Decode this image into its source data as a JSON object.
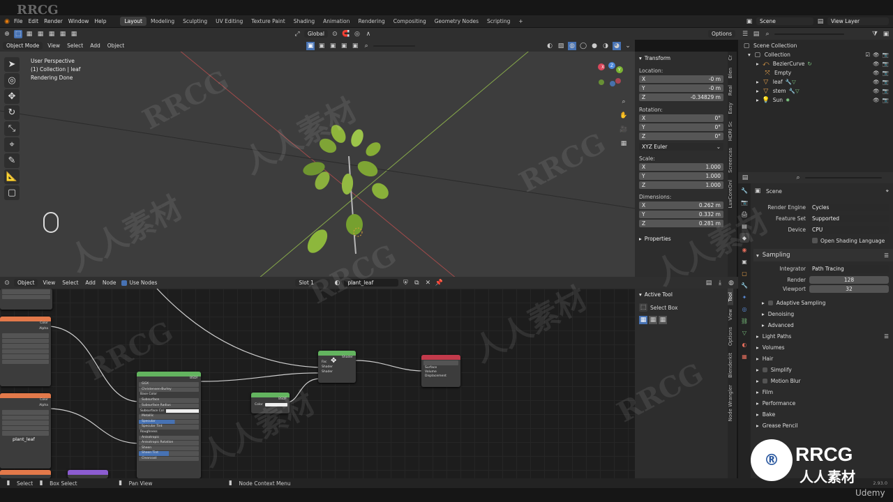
{
  "menubar": {
    "items": [
      "File",
      "Edit",
      "Render",
      "Window",
      "Help"
    ],
    "workspaces": [
      "Layout",
      "Modeling",
      "Sculpting",
      "UV Editing",
      "Texture Paint",
      "Shading",
      "Animation",
      "Rendering",
      "Compositing",
      "Geometry Nodes",
      "Scripting"
    ],
    "active_workspace": "Layout",
    "add_workspace": "+",
    "scene": "Scene",
    "view_layer": "View Layer"
  },
  "viewport": {
    "orientation": "Global",
    "options": "Options",
    "mode": "Object Mode",
    "menus": [
      "View",
      "Select",
      "Add",
      "Object"
    ],
    "overlay_text": [
      "User Perspective",
      "(1) Collection | leaf",
      "Rendering Done"
    ],
    "gizmo_axes": [
      "X",
      "Y",
      "Z"
    ]
  },
  "transform": {
    "title": "Transform",
    "location_label": "Location:",
    "location": {
      "x": "-0 m",
      "y": "-0 m",
      "z": "-0.34829 m"
    },
    "rotation_label": "Rotation:",
    "rotation": {
      "x": "0°",
      "y": "0°",
      "z": "0°"
    },
    "rotation_mode": "XYZ Euler",
    "scale_label": "Scale:",
    "scale": {
      "x": "1.000",
      "y": "1.000",
      "z": "1.000"
    },
    "dimensions_label": "Dimensions:",
    "dimensions": {
      "x": "0.262 m",
      "y": "0.332 m",
      "z": "0.281 m"
    },
    "properties": "Properties",
    "axis": [
      "X",
      "Y",
      "Z"
    ]
  },
  "vp_tabs": [
    "Cr",
    "Blen",
    "Real",
    "Easy",
    "HDRI Sc",
    "Screencas",
    "LuxCoreOnl"
  ],
  "outliner": {
    "scene_collection": "Scene Collection",
    "collection": "Collection",
    "items": [
      "BezierCurve",
      "Empty",
      "leaf",
      "stem",
      "Sun"
    ]
  },
  "props": {
    "scene": "Scene",
    "render_engine_label": "Render Engine",
    "render_engine": "Cycles",
    "feature_set_label": "Feature Set",
    "feature_set": "Supported",
    "device_label": "Device",
    "device": "CPU",
    "osl": "Open Shading Language",
    "sampling": "Sampling",
    "integrator_label": "Integrator",
    "integrator": "Path Tracing",
    "render_label": "Render",
    "render_samples": "128",
    "viewport_label": "Viewport",
    "viewport_samples": "32",
    "subsections": [
      "Adaptive Sampling",
      "Denoising",
      "Advanced"
    ],
    "panels": [
      "Light Paths",
      "Volumes",
      "Hair",
      "Simplify",
      "Motion Blur",
      "Film",
      "Performance",
      "Bake",
      "Grease Pencil"
    ],
    "version": "2.93.0"
  },
  "node_editor": {
    "object": "Object",
    "menus": [
      "View",
      "Select",
      "Add",
      "Node"
    ],
    "use_nodes": "Use Nodes",
    "slot": "Slot 1",
    "material": "plant_leaf",
    "image_label": "plant_leaf",
    "socket_labels": {
      "color": "Color",
      "alpha": "Alpha",
      "fac": "Fac",
      "shader": "Shader",
      "surface": "Surface",
      "volume": "Volume",
      "displacement": "Displacement",
      "bsdf": "BSDF",
      "base_color": "Base Color",
      "subsurface": "Subsurface",
      "subsurface_radius": "Subsurface Radius",
      "subsurface_color": "Subsurface Col",
      "metallic": "Metallic",
      "specular": "Specular",
      "specular_tint": "Specular Tint",
      "roughness": "Roughness",
      "anisotropic": "Anisotropic",
      "anisotropic_rotation": "Anisotropic Rotation",
      "sheen": "Sheen",
      "sheen_tint": "Sheen Tint",
      "clearcoat": "Clearcoat",
      "ggx": "GGX",
      "christensen_burley": "Christensen-Burley"
    },
    "active_tool": "Active Tool",
    "select_box": "Select Box"
  },
  "ne_tabs": [
    "Tool",
    "View",
    "Options",
    "Blenderkit",
    "Node Wrangler"
  ],
  "status": {
    "select": "Select",
    "box_select": "Box Select",
    "pan_view": "Pan View",
    "context_menu": "Node Context Menu"
  },
  "watermarks": [
    "RRCG",
    "人人素材"
  ],
  "branding": {
    "rrcg": "RRCG",
    "cn": "人人素材",
    "udemy": "Udemy"
  }
}
